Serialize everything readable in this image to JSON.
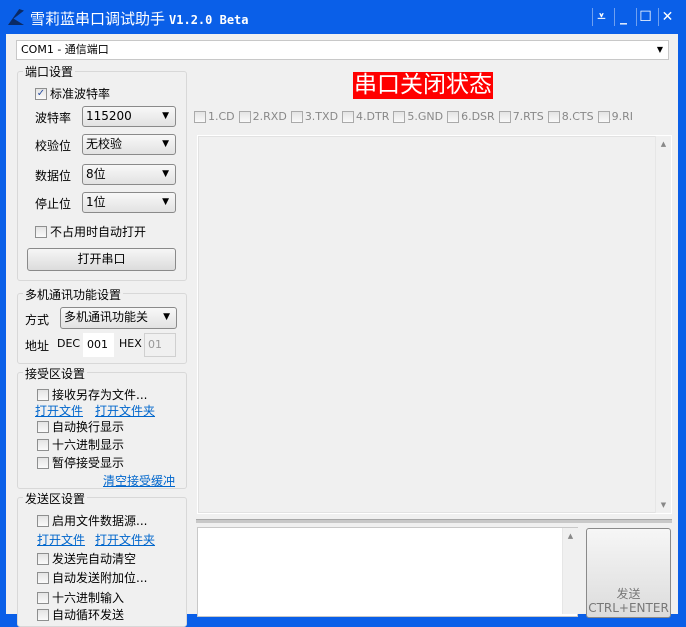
{
  "window": {
    "title": "雪莉蓝串口调试助手",
    "version": "V1.2.0 Beta",
    "buttons": [
      "menu",
      "minimize",
      "maximize",
      "close"
    ]
  },
  "port_combo": {
    "value": "COM1 - 通信端口"
  },
  "port_settings": {
    "title": "端口设置",
    "standard_baud": {
      "label": "标准波特率",
      "checked": true
    },
    "baud": {
      "label": "波特率",
      "value": "115200"
    },
    "parity": {
      "label": "校验位",
      "value": "无校验"
    },
    "databits": {
      "label": "数据位",
      "value": "8位"
    },
    "stopbits": {
      "label": "停止位",
      "value": "1位"
    },
    "auto_open": {
      "label": "不占用时自动打开",
      "checked": false
    },
    "open_button": "打开串口"
  },
  "multi": {
    "title": "多机通讯功能设置",
    "mode_label": "方式",
    "mode_value": "多机通讯功能关",
    "addr_label": "地址",
    "dec_label": "DEC",
    "dec_value": "001",
    "hex_label": "HEX",
    "hex_value": "01"
  },
  "receive": {
    "title": "接受区设置",
    "save_to_file": "接收另存为文件...",
    "open_file": "打开文件",
    "open_folder": "打开文件夹",
    "auto_wrap": "自动换行显示",
    "hex_display": "十六进制显示",
    "pause": "暂停接受显示",
    "clear": "清空接受缓冲"
  },
  "send": {
    "title": "发送区设置",
    "file_source": "启用文件数据源...",
    "open_file": "打开文件",
    "open_folder": "打开文件夹",
    "auto_clear": "发送完自动清空",
    "append_bits": "自动发送附加位...",
    "hex_input": "十六进制输入",
    "loop_send": "自动循环发送",
    "send_button": "发送",
    "send_shortcut": "CTRL+ENTER"
  },
  "status": {
    "text": "串口关闭状态",
    "color": "#ff0000"
  },
  "pins": [
    "1.CD",
    "2.RXD",
    "3.TXD",
    "4.DTR",
    "5.GND",
    "6.DSR",
    "7.RTS",
    "8.CTS",
    "9.RI"
  ]
}
